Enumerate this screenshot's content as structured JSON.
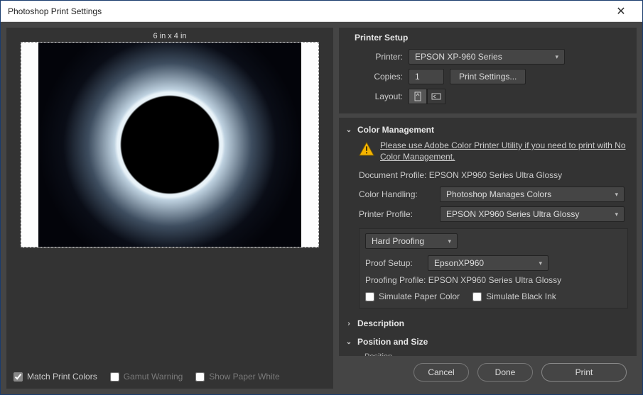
{
  "window": {
    "title": "Photoshop Print Settings"
  },
  "preview": {
    "size_label": "6 in x 4 in"
  },
  "left_checks": {
    "match": "Match Print Colors",
    "gamut": "Gamut Warning",
    "paper_white": "Show Paper White"
  },
  "printer_setup": {
    "title": "Printer Setup",
    "printer_label": "Printer:",
    "printer_value": "EPSON XP-960 Series",
    "copies_label": "Copies:",
    "copies_value": "1",
    "print_settings_btn": "Print Settings...",
    "layout_label": "Layout:"
  },
  "color_mgmt": {
    "title": "Color Management",
    "info_text": "Please use Adobe Color Printer Utility if you need to print with No Color Management.",
    "doc_profile_label": "Document Profile:",
    "doc_profile_value": "EPSON XP960 Series Ultra Glossy",
    "handling_label": "Color Handling:",
    "handling_value": "Photoshop Manages Colors",
    "printer_profile_label": "Printer Profile:",
    "printer_profile_value": "EPSON XP960 Series Ultra Glossy",
    "proofing_mode": "Hard Proofing",
    "proof_setup_label": "Proof Setup:",
    "proof_setup_value": "EpsonXP960",
    "proofing_profile_label": "Proofing Profile:",
    "proofing_profile_value": "EPSON XP960 Series Ultra Glossy",
    "sim_paper": "Simulate Paper Color",
    "sim_black": "Simulate Black Ink"
  },
  "description": {
    "title": "Description"
  },
  "position_size": {
    "title": "Position and Size",
    "sub": "Position"
  },
  "buttons": {
    "cancel": "Cancel",
    "done": "Done",
    "print": "Print"
  }
}
